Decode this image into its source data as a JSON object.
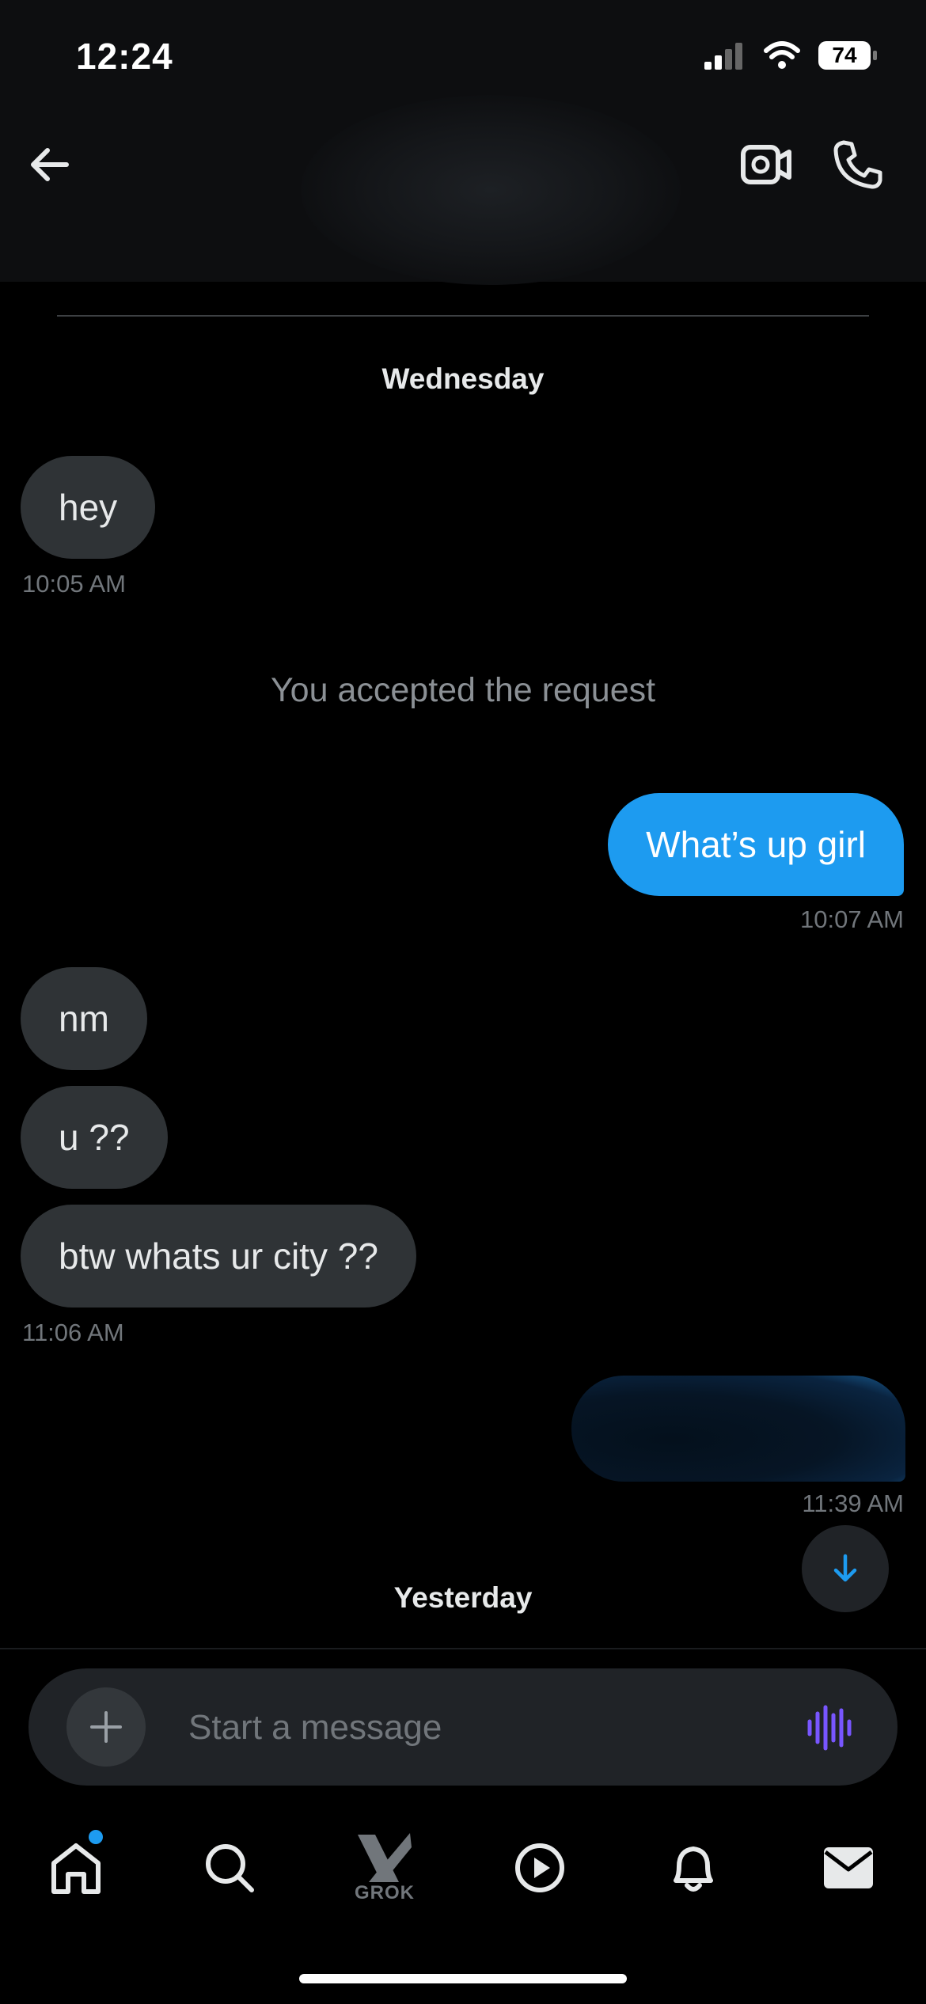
{
  "status_bar": {
    "time": "12:24",
    "battery": "74"
  },
  "chat": {
    "days": [
      "Wednesday",
      "Yesterday"
    ],
    "messages": [
      {
        "text": "hey",
        "time": "10:05 AM"
      },
      {
        "system": "You accepted the request"
      },
      {
        "text": "What’s up girl",
        "time": "10:07 AM"
      },
      {
        "text": "nm"
      },
      {
        "text": "u ??"
      },
      {
        "text": "btw whats ur city ??",
        "time": "11:06 AM"
      },
      {
        "time": "11:39 AM"
      }
    ]
  },
  "composer": {
    "placeholder": "Start a message"
  },
  "tabs": {
    "grok_label": "GROK"
  },
  "colors": {
    "accent": "#1d9bf0",
    "incoming_bubble": "#2f3336",
    "voice_icon": "#7856ff",
    "background": "#000000"
  },
  "icons": [
    "back-arrow-icon",
    "video-call-icon",
    "phone-icon",
    "plus-icon",
    "voice-wave-icon",
    "arrow-down-icon",
    "home-icon",
    "search-icon",
    "grok-icon",
    "play-icon",
    "bell-icon",
    "mail-icon"
  ]
}
